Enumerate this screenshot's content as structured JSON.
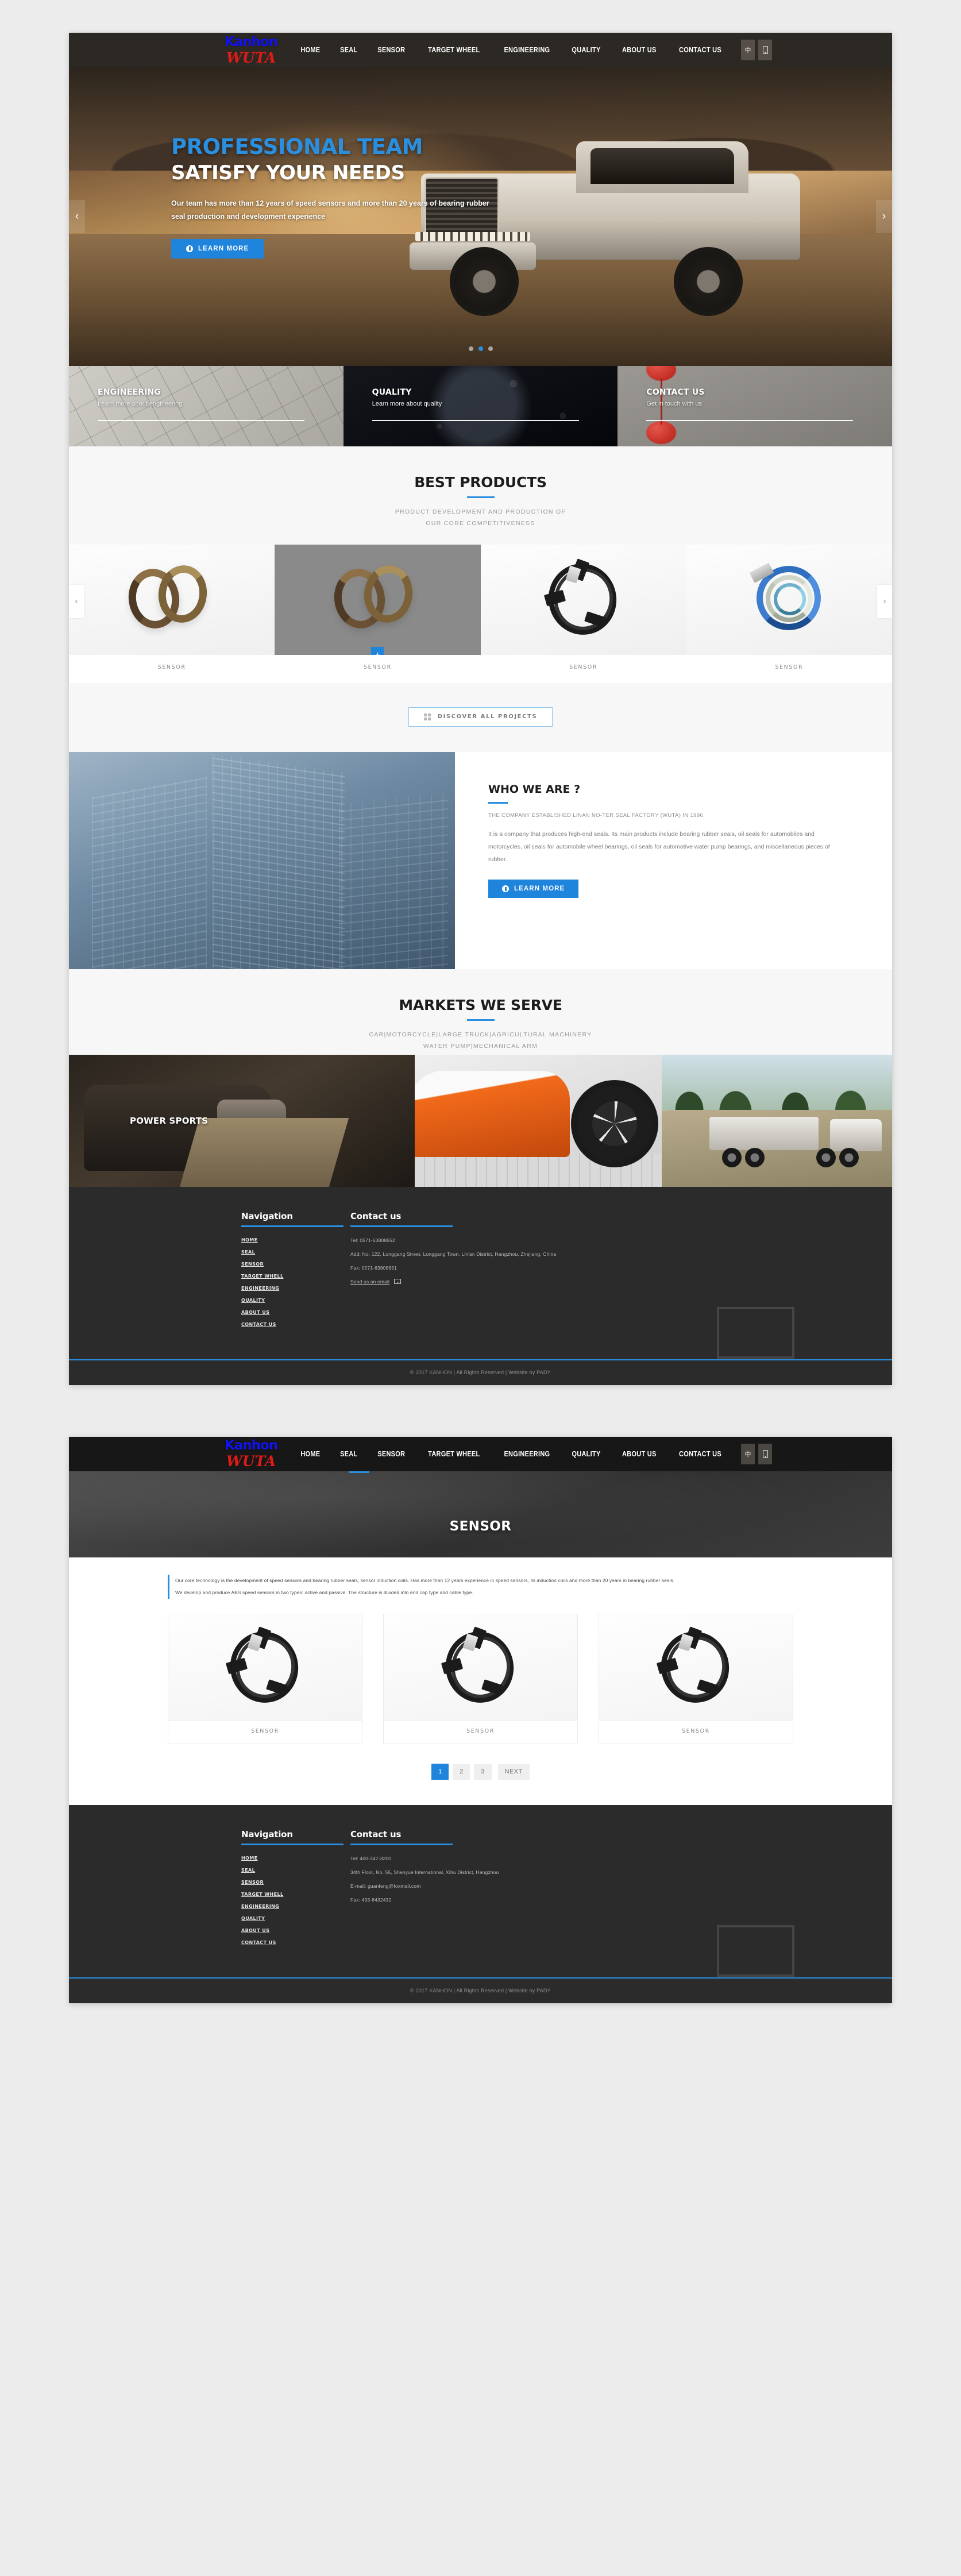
{
  "brand": {
    "line1": "Kanhon",
    "line2": "WUTA"
  },
  "nav": {
    "items": [
      "HOME",
      "SEAL",
      "SENSOR",
      "TARGET WHEEL",
      "ENGINEERING",
      "QUALITY",
      "ABOUT US",
      "CONTACT US"
    ],
    "lang_button": "中",
    "mobile_button": "⬚"
  },
  "hero": {
    "title_blue": "PROFESSIONAL TEAM",
    "title_white": "SATISFY YOUR NEEDS",
    "paragraph": "Our team has more than 12 years of speed sensors and more than 20 years of bearing rubber seal production and development experience",
    "cta": "LEARN MORE",
    "prev": "‹",
    "next": "›",
    "dots": 3,
    "active_dot": 1
  },
  "tiles": [
    {
      "title": "ENGINEERING",
      "sub": "Learn more about engineering"
    },
    {
      "title": "QUALITY",
      "sub": "Learn more about quality"
    },
    {
      "title": "CONTACT US",
      "sub": "Get in touch with us"
    }
  ],
  "best_products": {
    "title": "BEST PRODUCTS",
    "sub_line1": "PRODUCT DEVELOPMENT AND PRODUCTION OF",
    "sub_line2": "OUR CORE COMPETITIVENESS",
    "cards": [
      {
        "caption": "SENSOR"
      },
      {
        "caption": "SENSOR"
      },
      {
        "caption": "SENSOR"
      },
      {
        "caption": "SENSOR"
      }
    ],
    "plus": "+",
    "prev": "‹",
    "next": "›",
    "discover_label": "DISCOVER ALL PROJECTS"
  },
  "who_we_are": {
    "title": "WHO WE ARE ?",
    "lead": "THE COMPANY ESTABLISHED LINAN NO-TER SEAL FACTORY (WUTA) IN 1996.",
    "body": "It is a company that produces high-end seals. Its main products include bearing rubber seals, oil seals for automobiles and motorcycles, oil seals for automobile wheel bearings, oil seals for automotive water pump bearings, and miscellaneous pieces of rubber.",
    "cta": "LEARN MORE"
  },
  "markets": {
    "title": "MARKETS WE SERVE",
    "sub_line1": "CAR|MOTORCYCLE|LARGE TRUCK|AGRICULTURAL MACHINERY",
    "sub_line2": "WATER PUMP|MECHANICAL ARM",
    "panel1_label": "POWER SPORTS"
  },
  "footer1": {
    "nav_title": "Navigation",
    "contact_title": "Contact us",
    "links": [
      "HOME",
      "SEAL",
      "SENSOR",
      "TARGET WHELL",
      "ENGINEERING",
      "QUALITY",
      "ABOUT US",
      "CONTACT US"
    ],
    "tel": "Tel:  0571-63808652",
    "address": "Add:  No. 122, Longgang Street, Longgang Town, Lin'an District, Hangzhou, Zhejiang, China",
    "fax": "Fax:  0571-63808651",
    "email_label": "Send us an email",
    "copyright": "© 2017 KANHON | All Rights Reserved | Website by PADY"
  },
  "page2": {
    "banner_title": "SENSOR",
    "intro_line1": "Our core technology is the development of speed sensors and bearing rubber seals, sensor induction coils. Has more than 12 years experience in speed sensors, its induction coils and more than 20 years in bearing rubber seals.",
    "intro_line2": "We develop and produce ABS speed sensors in two types: active and passive. The structure is divided into end cap type and cable type.",
    "cards": [
      {
        "caption": "SENSOR"
      },
      {
        "caption": "SENSOR"
      },
      {
        "caption": "SENSOR"
      }
    ],
    "pagination": [
      "1",
      "2",
      "3",
      "NEXT"
    ],
    "active_page": "1"
  },
  "footer2": {
    "nav_title": "Navigation",
    "contact_title": "Contact us",
    "links": [
      "HOME",
      "SEAL",
      "SENSOR",
      "TARGET WHELL",
      "ENGINEERING",
      "QUALITY",
      "ABOUT US",
      "CONTACT US"
    ],
    "tel": "Tel:  400-347-3200",
    "address": "34th Floor, No. 55, Shenyue International, Xihu District, Hangzhou",
    "email": "E-mail: guanfeng@foxmail.com",
    "fax": "Fax:  433-8432432",
    "copyright": "© 2017 KANHON | All Rights Reserved | Website by PADY"
  },
  "colors": {
    "accent": "#1f84db",
    "accent_light": "#2b8fe0",
    "dark": "#2b2b2b",
    "logo_blue": "#1313ee",
    "logo_red": "#e01b16"
  }
}
